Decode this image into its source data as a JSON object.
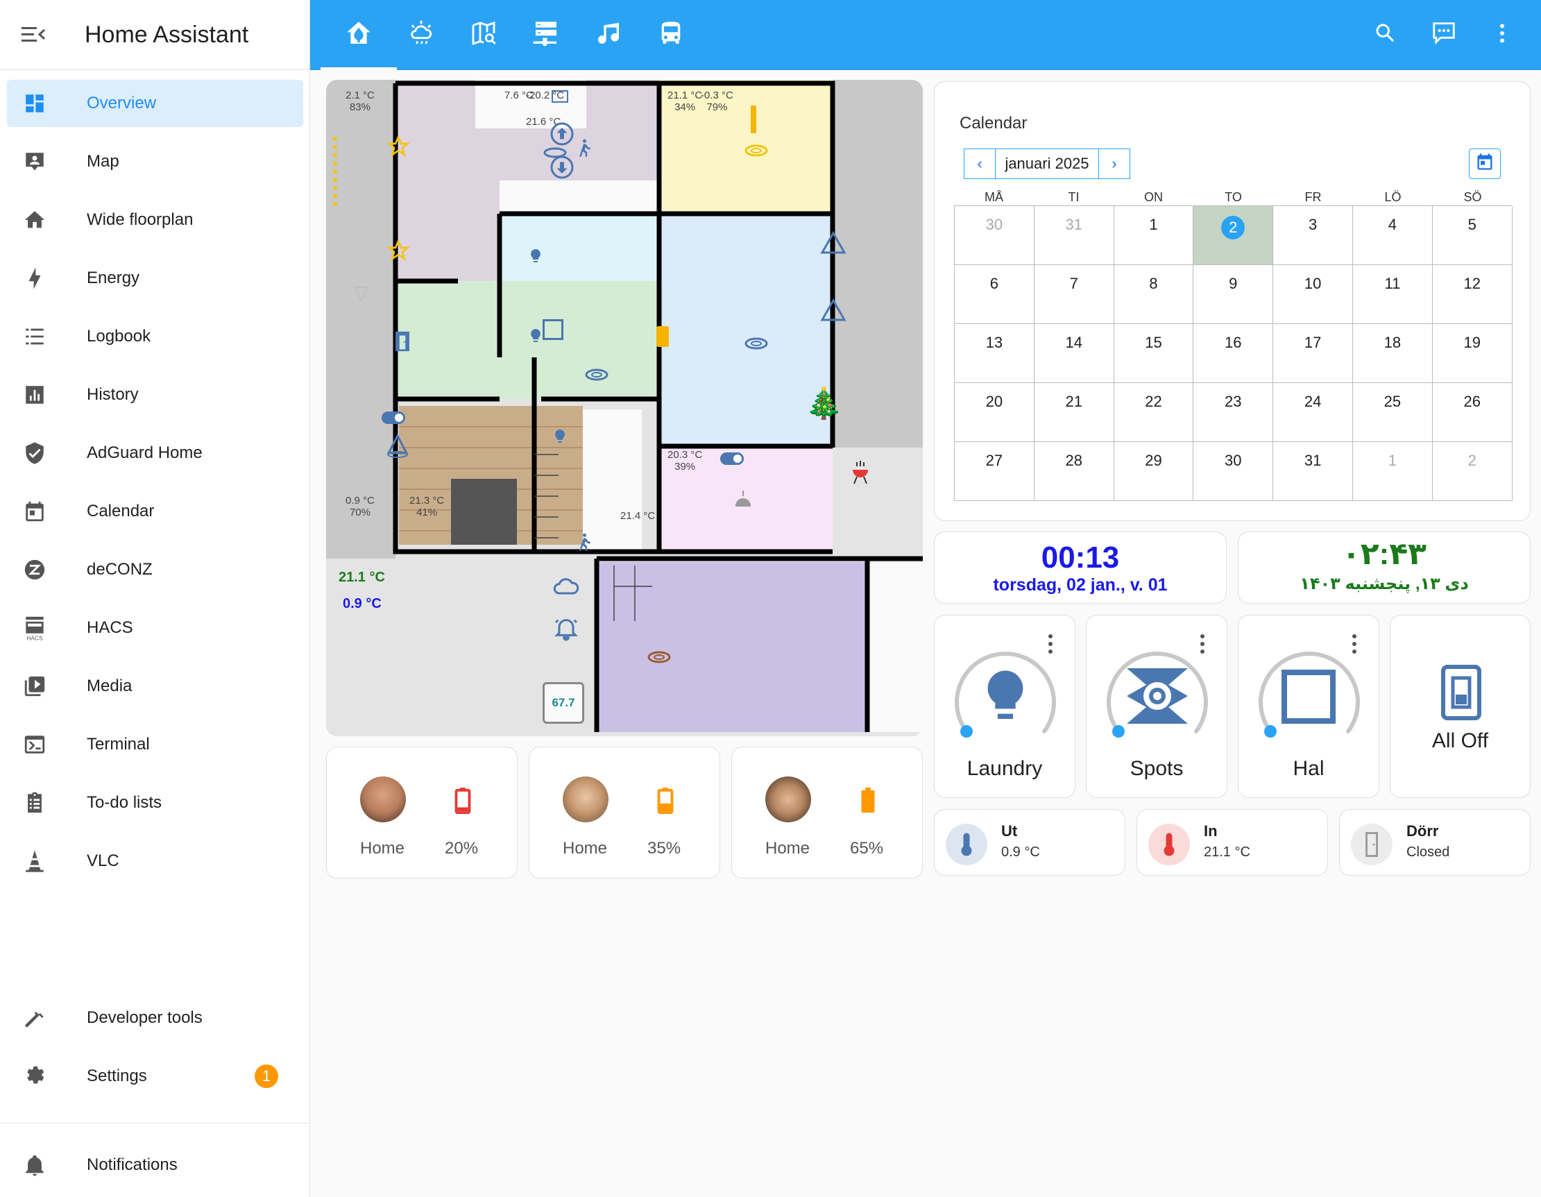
{
  "app": {
    "title": "Home Assistant"
  },
  "sidebar": {
    "items": [
      {
        "label": "Overview",
        "icon": "view-dashboard-icon"
      },
      {
        "label": "Map",
        "icon": "account-box-icon"
      },
      {
        "label": "Wide floorplan",
        "icon": "home-icon"
      },
      {
        "label": "Energy",
        "icon": "lightning-bolt-icon"
      },
      {
        "label": "Logbook",
        "icon": "format-list-bulleted-icon"
      },
      {
        "label": "History",
        "icon": "chart-box-icon"
      },
      {
        "label": "AdGuard Home",
        "icon": "shield-check-icon"
      },
      {
        "label": "Calendar",
        "icon": "calendar-icon"
      },
      {
        "label": "deCONZ",
        "icon": "zigbee-icon"
      },
      {
        "label": "HACS",
        "icon": "hacs-icon"
      },
      {
        "label": "Media",
        "icon": "play-box-multiple-icon"
      },
      {
        "label": "Terminal",
        "icon": "console-icon"
      },
      {
        "label": "To-do lists",
        "icon": "clipboard-list-icon"
      },
      {
        "label": "VLC",
        "icon": "vlc-cone-icon"
      }
    ],
    "developer_tools": "Developer tools",
    "settings": "Settings",
    "settings_badge": "1",
    "notifications": "Notifications"
  },
  "topbar": {
    "tabs": [
      "home-floorplan-icon",
      "weather-cloud-icon",
      "map-search-icon",
      "server-network-icon",
      "music-note-icon",
      "bus-icon"
    ],
    "actions": [
      "search-icon",
      "assist-chat-icon",
      "more-vertical-icon"
    ],
    "color": "#2aa3f5"
  },
  "floorplan": {
    "labels": {
      "outdoor_nw": "2.1 °C\n83%",
      "kitchen_a": "7.6 °C",
      "kitchen_b": "-20.2 °C",
      "kitchen_c": "21.6 °C",
      "bedroom": "21.1 °C\n34%",
      "outdoor_ne": "-0.3 °C\n79%",
      "office": "20.3 °C\n39%",
      "porch": "0.9 °C\n70%",
      "living": "21.3 °C\n41%",
      "stairs": "21.4 °C",
      "summary_in": "21.1 °C",
      "summary_out": "0.9 °C",
      "cpu_temp": "67.7"
    }
  },
  "calendar": {
    "title": "Calendar",
    "month": "januari 2025",
    "dow": [
      "MÅ",
      "TI",
      "ON",
      "TO",
      "FR",
      "LÖ",
      "SÖ"
    ],
    "weeks": [
      [
        "30",
        "31",
        "1",
        "2",
        "3",
        "4",
        "5"
      ],
      [
        "6",
        "7",
        "8",
        "9",
        "10",
        "11",
        "12"
      ],
      [
        "13",
        "14",
        "15",
        "16",
        "17",
        "18",
        "19"
      ],
      [
        "20",
        "21",
        "22",
        "23",
        "24",
        "25",
        "26"
      ],
      [
        "27",
        "28",
        "29",
        "30",
        "31",
        "1",
        "2"
      ]
    ],
    "today": "2"
  },
  "clock": {
    "time": "00:13",
    "date": "torsdag, 02 jan., v. 01"
  },
  "persian_clock": {
    "time": "۰۲:۴۳",
    "date": "دی ۱۳, پنجشنبه ۱۴۰۳"
  },
  "lights": [
    {
      "name": "Laundry",
      "icon": "lightbulb-icon"
    },
    {
      "name": "Spots",
      "icon": "spotlight-icon"
    },
    {
      "name": "Hal",
      "icon": "square-outline-icon"
    }
  ],
  "all_off": {
    "name": "All Off",
    "icon": "light-switch-icon"
  },
  "entities": [
    {
      "name": "Ut",
      "state": "0.9 °C",
      "icon": "thermometer-icon",
      "color": "#4a77b0"
    },
    {
      "name": "In",
      "state": "21.1 °C",
      "icon": "thermometer-icon",
      "color": "#e53935"
    },
    {
      "name": "Dörr",
      "state": "Closed",
      "icon": "door-closed-icon",
      "color": "#9e9e9e"
    }
  ],
  "persons": [
    {
      "location": "Home",
      "battery": "20%",
      "battery_color": "#e53935"
    },
    {
      "location": "Home",
      "battery": "35%",
      "battery_color": "#ff9800"
    },
    {
      "location": "Home",
      "battery": "65%",
      "battery_color": "#ff9800"
    }
  ]
}
